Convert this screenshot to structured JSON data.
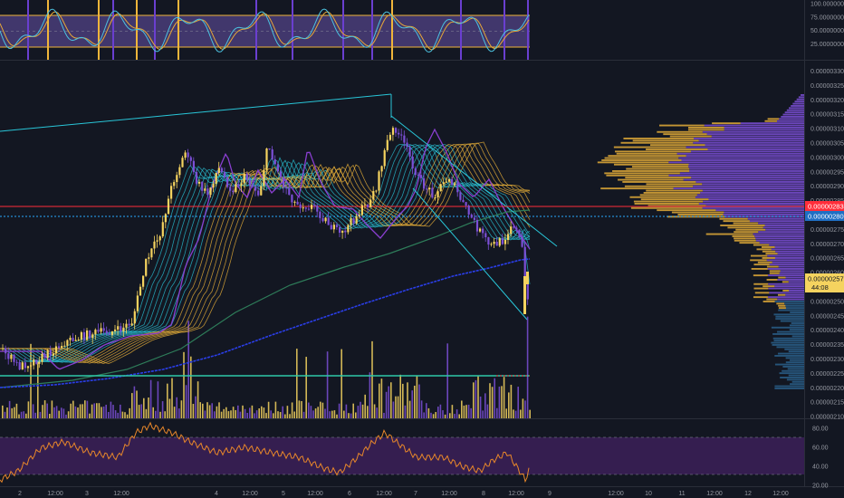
{
  "colors": {
    "background": "#131722",
    "bull": "#f5d35f",
    "bear": "#7b4fd6",
    "fast_ribbon": "#29c6d8",
    "slow_ribbon": "#f0b53a",
    "ema_blue": "#2a3ee8",
    "ema_green": "#2e7d5a",
    "support_line": "#2ec9a8",
    "resistance_line": "#ff2e3a",
    "dotted_line": "#29a8ff",
    "rsi_line": "#e8872a",
    "stoch_k": "#4cc2e0",
    "stoch_d": "#e8a838",
    "price_tag": "#f5d35f",
    "grid_text": "#9598a1"
  },
  "stochastic": {
    "axis_labels": [
      "100.00000000",
      "75.00000000",
      "50.00000000",
      "25.00000000"
    ],
    "ylim": [
      0,
      100
    ],
    "bands": [
      25,
      75
    ]
  },
  "rsi": {
    "axis_labels": [
      "80.00",
      "60.00",
      "40.00",
      "20.00"
    ],
    "ylim": [
      20,
      80
    ],
    "bands": [
      30,
      70
    ]
  },
  "price_axis": {
    "labels": [
      "0.00000330",
      "0.00000325",
      "0.00000320",
      "0.00000315",
      "0.00000310",
      "0.00000305",
      "0.00000300",
      "0.00000295",
      "0.00000290",
      "0.00000285",
      "0.00000280",
      "0.00000275",
      "0.00000270",
      "0.00000265",
      "0.00000260",
      "0.00000255",
      "0.00000250",
      "0.00000245",
      "0.00000240",
      "0.00000235",
      "0.00000230",
      "0.00000225",
      "0.00000220",
      "0.00000215",
      "0.00000210"
    ],
    "current_price": "0.00000257",
    "countdown": "44:08",
    "red_level_label": "0.00000283",
    "blue_level_label": "0.00000280"
  },
  "time_axis": {
    "labels": [
      "2",
      "12:00",
      "3",
      "12:00",
      "4",
      "12:00",
      "5",
      "12:00",
      "6",
      "12:00",
      "7",
      "12:00",
      "8",
      "12:00",
      "9",
      "12:00",
      "10",
      "11",
      "12:00",
      "12",
      "12:00",
      "13",
      "12:00"
    ]
  },
  "chart_data": {
    "type": "candlestick",
    "title": "",
    "xlabel": "",
    "ylabel": "",
    "ylim": [
      2.1e-06,
      3.3e-06
    ],
    "candles_close_approx": [
      2.26e-06,
      2.3e-06,
      2.35e-06,
      2.4e-06,
      2.44e-06,
      2.47e-06,
      2.49e-06,
      2.55e-06,
      2.7e-06,
      2.85e-06,
      3.02e-06,
      2.95e-06,
      2.9e-06,
      2.93e-06,
      2.88e-06,
      2.85e-06,
      2.82e-06,
      2.75e-06,
      2.72e-06,
      2.8e-06,
      3e-06,
      3.12e-06,
      3.05e-06,
      2.96e-06,
      2.9e-06,
      2.83e-06,
      2.75e-06,
      2.68e-06,
      2.74e-06,
      2.62e-06,
      2.45e-06,
      2.57e-06
    ],
    "resistance_level": 2.83e-06,
    "dotted_level": 2.8e-06,
    "support_level": 2.22e-06
  }
}
